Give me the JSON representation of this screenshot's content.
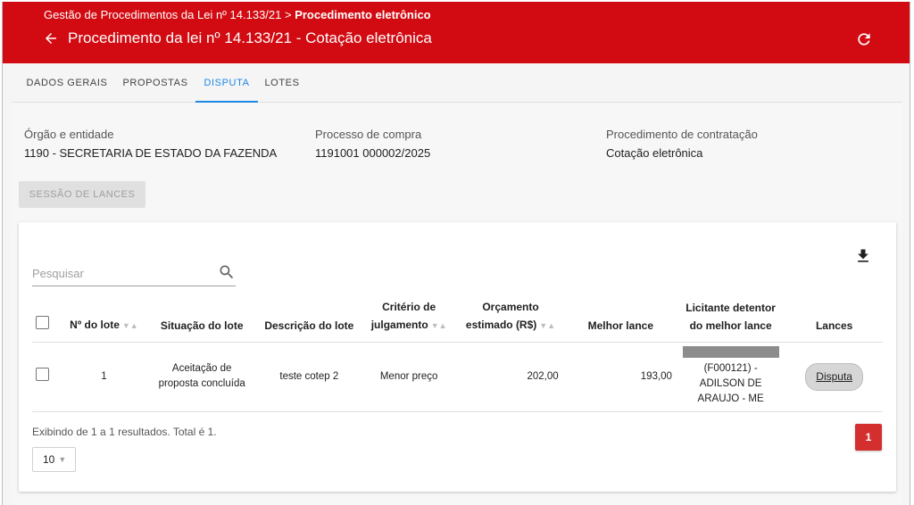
{
  "header": {
    "breadcrumb_parent": "Gestão de Procedimentos da Lei nº 14.133/21",
    "breadcrumb_sep": " > ",
    "breadcrumb_current": "Procedimento eletrônico",
    "title": "Procedimento da lei nº 14.133/21 - Cotação eletrônica",
    "back_icon": "arrow-left-icon",
    "refresh_icon": "refresh-icon",
    "color": "#d20a11"
  },
  "tabs": [
    {
      "label": "DADOS GERAIS",
      "active": false
    },
    {
      "label": "PROPOSTAS",
      "active": false
    },
    {
      "label": "DISPUTA",
      "active": true
    },
    {
      "label": "LOTES",
      "active": false
    }
  ],
  "info": {
    "orgao_label": "Órgão e entidade",
    "orgao_value": "1190 - SECRETARIA DE ESTADO DA FAZENDA",
    "processo_label": "Processo de compra",
    "processo_value": "1191001 000002/2025",
    "procedimento_label": "Procedimento de contratação",
    "procedimento_value": "Cotação eletrônica"
  },
  "session_button": "SESSÃO DE LANCES",
  "search": {
    "placeholder": "Pesquisar"
  },
  "table": {
    "columns": {
      "lote": "Nº do lote",
      "situacao": "Situação do lote",
      "descricao": "Descrição do lote",
      "criterio_1": "Critério de",
      "criterio_2": "julgamento",
      "orcamento_1": "Orçamento",
      "orcamento_2": "estimado (R$)",
      "melhor": "Melhor lance",
      "licitante_1": "Licitante detentor",
      "licitante_2": "do melhor lance",
      "lances": "Lances"
    },
    "rows": [
      {
        "lote": "1",
        "situacao_1": "Aceitação de",
        "situacao_2": "proposta concluída",
        "descricao": "teste cotep 2",
        "criterio": "Menor preço",
        "orcamento": "202,00",
        "melhor": "193,00",
        "licitante_1": "(F000121) -",
        "licitante_2": "ADILSON DE",
        "licitante_3": "ARAUJO - ME",
        "lances": "Disputa"
      }
    ]
  },
  "footer": {
    "summary": "Exibindo de 1 a 1 resultados. Total é 1.",
    "page_size": "10",
    "current_page": "1"
  }
}
